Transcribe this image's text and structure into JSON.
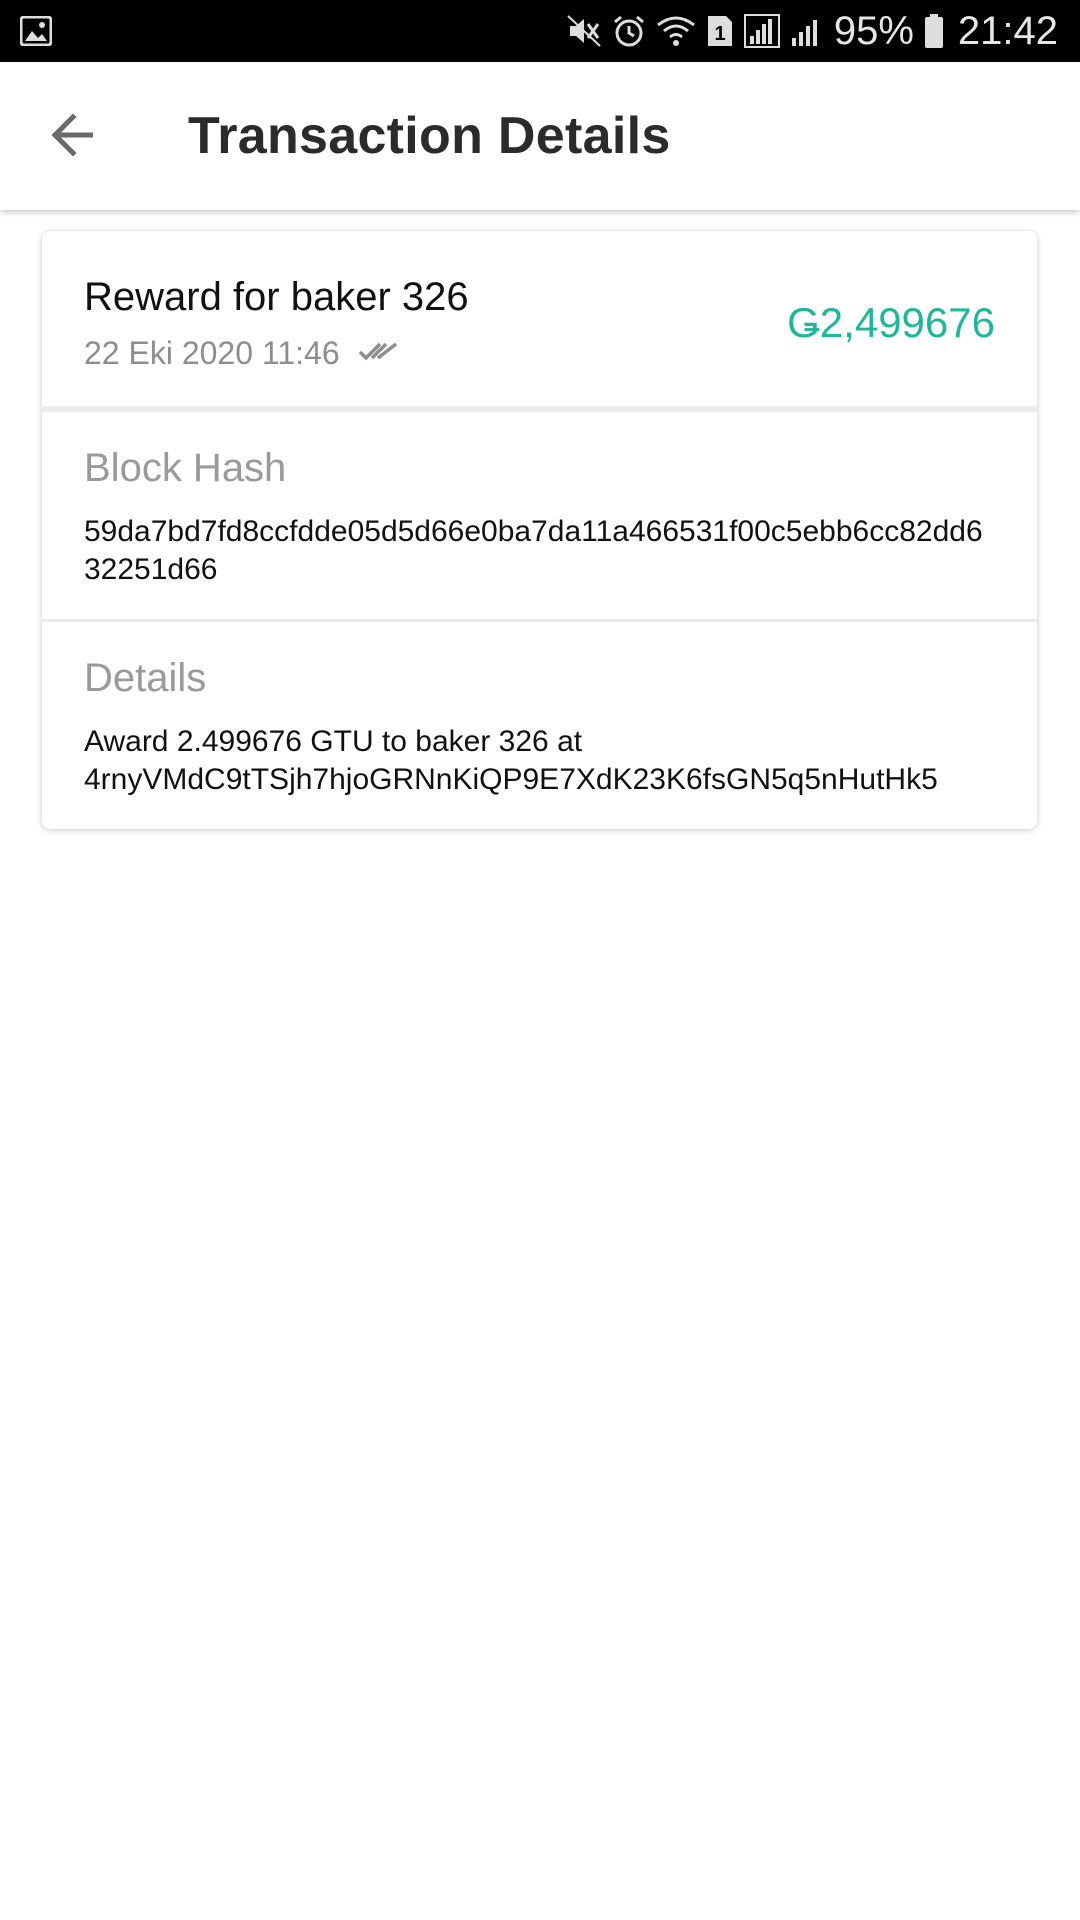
{
  "status_bar": {
    "battery": "95%",
    "time": "21:42",
    "sim_slot": "1",
    "icons": [
      "gallery-icon",
      "mute-icon",
      "alarm-icon",
      "wifi-icon",
      "sim-icon",
      "signal-icon",
      "signal-icon",
      "battery-icon"
    ]
  },
  "header": {
    "title": "Transaction Details",
    "back_icon": "arrow-left-icon"
  },
  "transaction": {
    "title": "Reward for baker 326",
    "date": "22 Eki 2020 11:46",
    "status_icon": "double-check-icon",
    "amount": "Ǥ2,499676",
    "amount_color": "#1fb79a"
  },
  "block_hash": {
    "label": "Block Hash",
    "value": "59da7bd7fd8ccfdde05d5d66e0ba7da11a466531f00c5ebb6cc82dd632251d66"
  },
  "details": {
    "label": "Details",
    "line1": "Award 2.499676 GTU to baker 326 at",
    "line2": "4rnyVMdC9tTSjh7hjoGRNnKiQP9E7XdK23K6fsGN5q5nHutHk5"
  }
}
